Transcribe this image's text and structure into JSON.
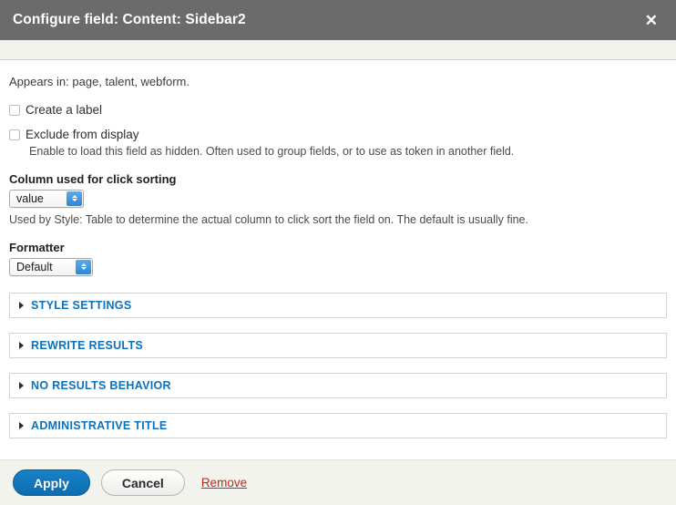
{
  "dialog": {
    "title": "Configure field: Content: Sidebar2",
    "close_label": "✕"
  },
  "body": {
    "appears_in": "Appears in: page, talent, webform.",
    "create_label": {
      "label": "Create a label",
      "checked": false
    },
    "exclude_from_display": {
      "label": "Exclude from display",
      "checked": false,
      "description": "Enable to load this field as hidden. Often used to group fields, or to use as token in another field."
    },
    "click_sorting": {
      "label": "Column used for click sorting",
      "value": "value",
      "description": "Used by Style: Table to determine the actual column to click sort the field on. The default is usually fine."
    },
    "formatter": {
      "label": "Formatter",
      "value": "Default"
    }
  },
  "sections": [
    {
      "title": "Style settings",
      "expanded": false
    },
    {
      "title": "Rewrite results",
      "expanded": false
    },
    {
      "title": "No results behavior",
      "expanded": false
    },
    {
      "title": "Administrative title",
      "expanded": false
    }
  ],
  "footer": {
    "apply_label": "Apply",
    "cancel_label": "Cancel",
    "remove_label": "Remove"
  },
  "colors": {
    "titlebar_bg": "#6b6b6b",
    "accent_blue": "#0d72ba",
    "danger_red": "#c0281a",
    "subhead_bg": "#f2f2ec",
    "footer_bg": "#f3f3ee"
  }
}
